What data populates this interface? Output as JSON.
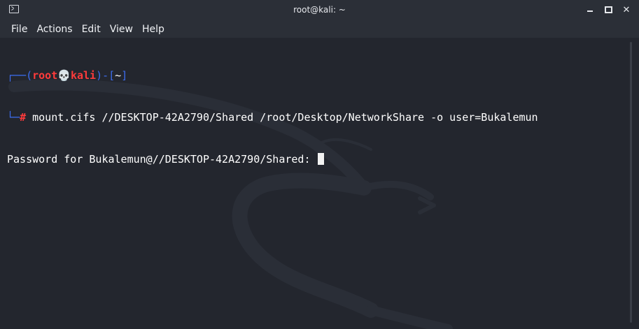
{
  "window": {
    "title": "root@kali: ~",
    "icon": "terminal-icon",
    "controls": [
      "minimize-icon",
      "maximize-icon",
      "close-icon"
    ]
  },
  "menu": {
    "items": [
      "File",
      "Actions",
      "Edit",
      "View",
      "Help"
    ]
  },
  "terminal": {
    "prompt": {
      "corner_top": "┌──(",
      "user": "root",
      "skull": "💀",
      "host": "kali",
      "mid": ")-[",
      "cwd": "~",
      "close": "]",
      "corner_bottom": "└─",
      "symbol": "#"
    },
    "command": " mount.cifs //DESKTOP-42A2790/Shared /root/Desktop/NetworkShare -o user=Bukalemun",
    "output": "Password for Bukalemun@//DESKTOP-42A2790/Shared: "
  },
  "colors": {
    "background": "#23262e",
    "prompt_frame": "#3c6df0",
    "prompt_user_host": "#ff3b3b",
    "text": "#ffffff"
  }
}
